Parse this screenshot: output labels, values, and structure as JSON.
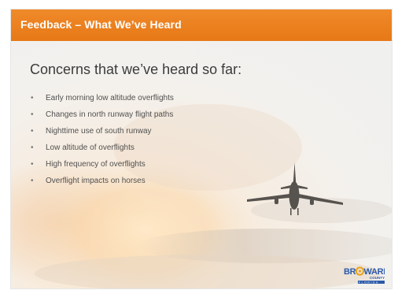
{
  "header": {
    "title": "Feedback – What We’ve Heard",
    "color": "#EC7F1F"
  },
  "heading": "Concerns that we’ve heard so far:",
  "bullets": [
    "Early morning low altitude overflights",
    "Changes in north runway flight paths",
    "Nighttime use of south runway",
    "Low altitude of overflights",
    "High frequency of overflights",
    "Overflight impacts on horses"
  ],
  "bullet_glyph": "•",
  "logo": {
    "text": "BROWARD COUNTY FLORIDA"
  }
}
